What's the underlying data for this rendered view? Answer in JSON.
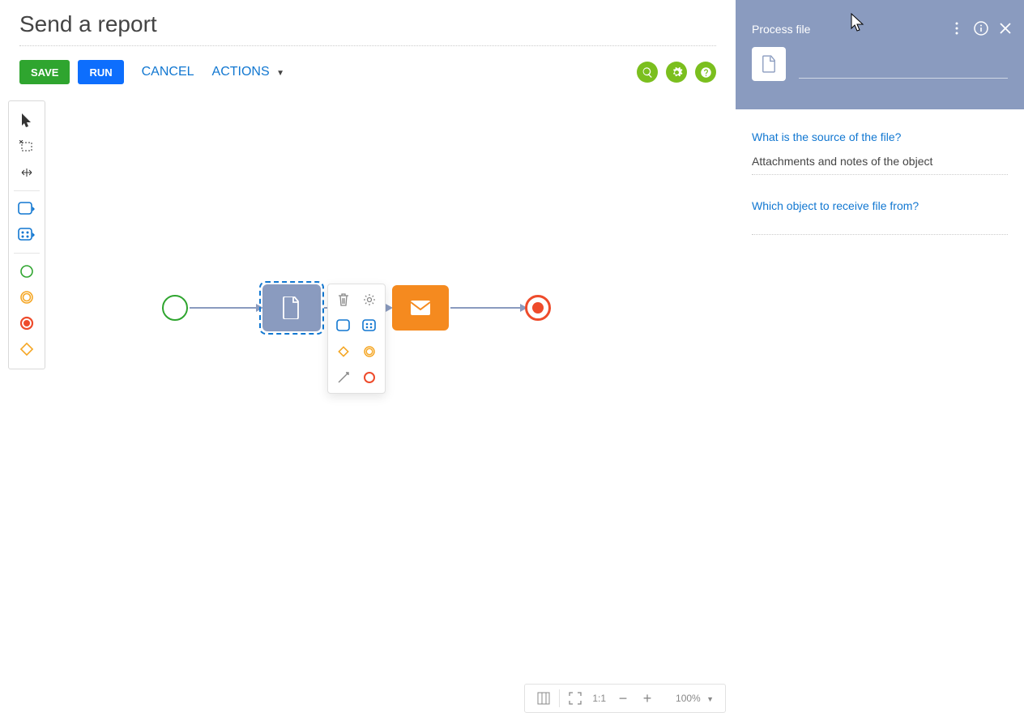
{
  "page": {
    "title": "Send a report"
  },
  "toolbar": {
    "save": "SAVE",
    "run": "RUN",
    "cancel": "CANCEL",
    "actions": "ACTIONS"
  },
  "palette_tools": [
    "pointer",
    "lasso-select",
    "horizontal-resize",
    "user-task",
    "service-task",
    "start-event-green",
    "intermediate-event-orange",
    "end-event-red",
    "gateway-diamond"
  ],
  "canvas": {
    "selected_node": "process-file",
    "nodes": [
      "start",
      "process-file",
      "send-email",
      "end"
    ]
  },
  "context_menu": {
    "items": [
      "delete",
      "settings",
      "user-task",
      "service-task",
      "gateway",
      "intermediate-event",
      "sequence-flow",
      "end-event"
    ]
  },
  "zoom": {
    "ratio_label": "1:1",
    "percent": "100%"
  },
  "side_panel": {
    "title": "Process file",
    "name_value": "",
    "q1_label": "What is the source of the file?",
    "q1_value": "Attachments and notes of the object",
    "q2_label": "Which object to receive file from?",
    "q2_value": ""
  }
}
